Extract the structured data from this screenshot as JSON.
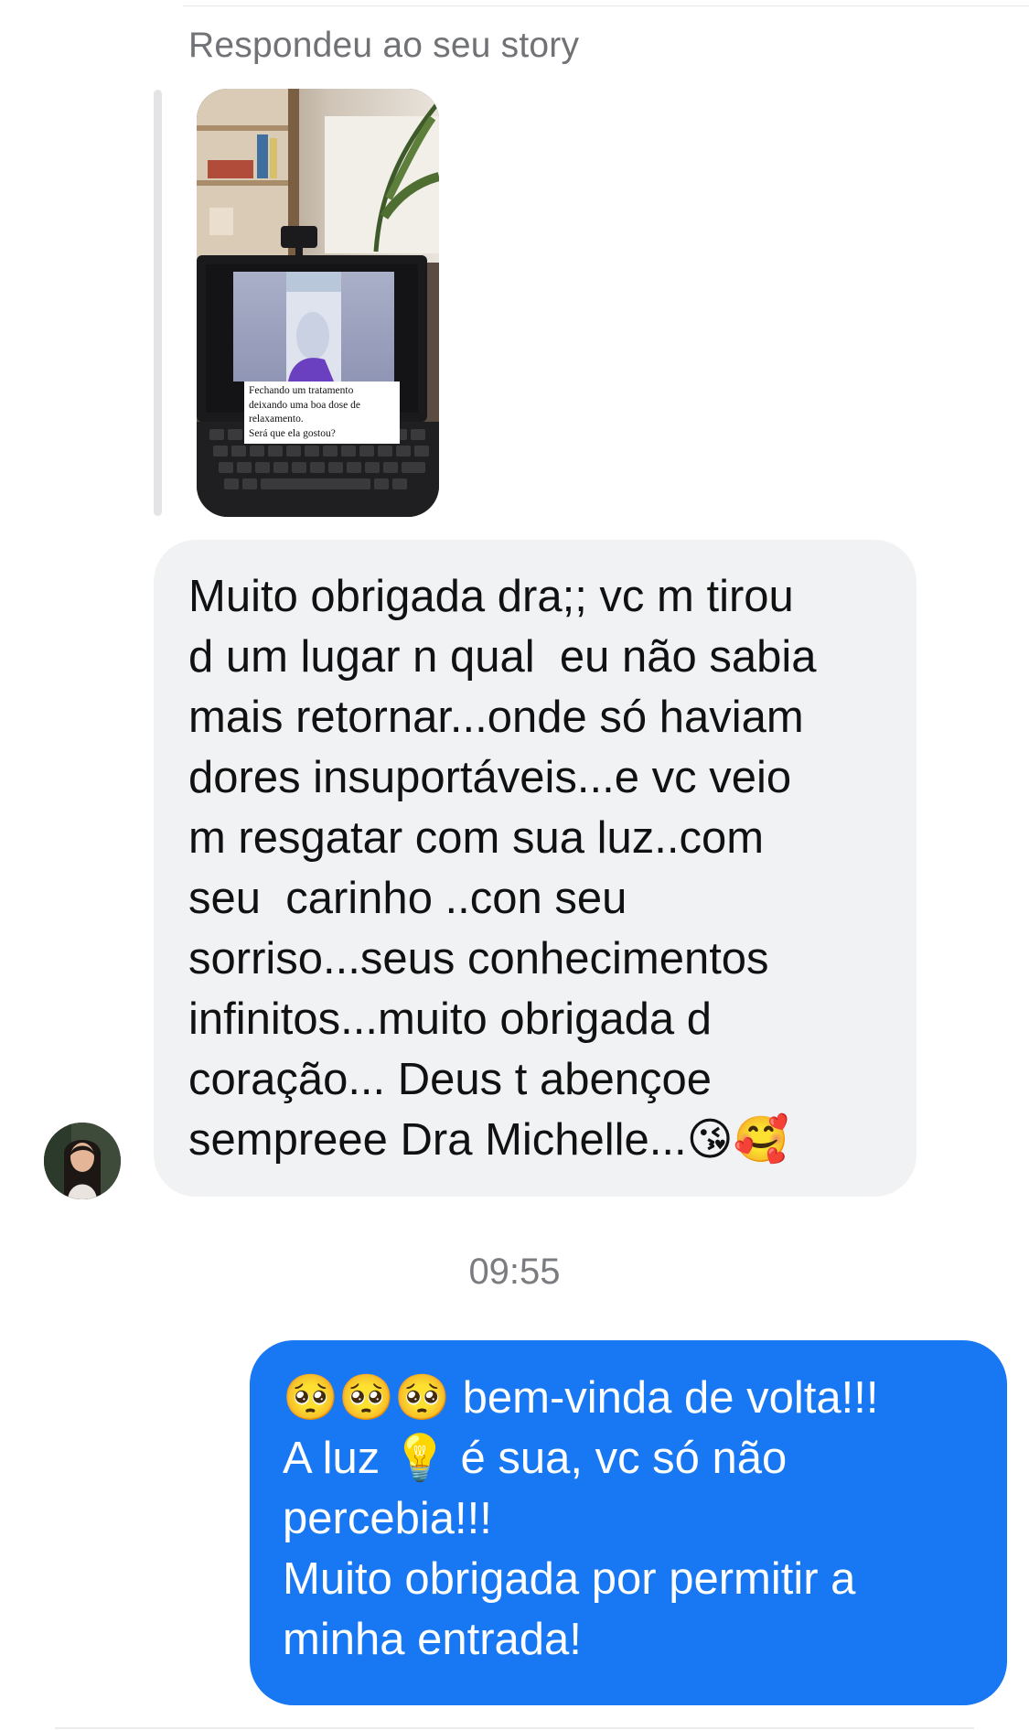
{
  "story_reply": {
    "label": "Respondeu ao seu story",
    "story_text": [
      "Fechando um tratamento",
      "deixando uma boa dose de",
      "relaxamento.",
      "Será que ela gostou?"
    ]
  },
  "incoming_message": {
    "lines": [
      "Muito obrigada dra;; vc m tirou",
      "d um lugar n qual  eu não sabia",
      "mais retornar...onde só haviam",
      "dores insuportáveis...e vc veio",
      "m resgatar com sua luz..com",
      "seu  carinho ..con seu",
      "sorriso...seus conhecimentos",
      "infinitos...muito obrigada d",
      "coração... Deus t abençoe",
      "sempreee Dra Michelle...😘🥰"
    ]
  },
  "timestamp": "09:55",
  "outgoing_message": {
    "lines": [
      "🥺🥺🥺 bem-vinda de volta!!!",
      "A luz 💡 é sua, vc só não",
      "percebia!!!",
      "Muito obrigada por permitir a",
      "minha entrada!"
    ]
  },
  "colors": {
    "outgoing_bubble": "#1877f2",
    "incoming_bubble": "#f1f2f4",
    "secondary_text": "#707276"
  }
}
